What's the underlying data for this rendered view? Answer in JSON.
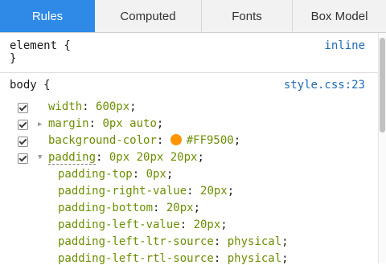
{
  "tabs": [
    {
      "label": "Rules"
    },
    {
      "label": "Computed"
    },
    {
      "label": "Fonts"
    },
    {
      "label": "Box Model"
    }
  ],
  "element_rule": {
    "selector": "element {",
    "close": "}",
    "origin": "inline"
  },
  "body_rule": {
    "selector": "body {",
    "origin": "style.css:23",
    "props": [
      {
        "name": "width",
        "value": "600px"
      },
      {
        "name": "margin",
        "value": "0px auto"
      },
      {
        "name": "background-color",
        "value": "#FF9500",
        "swatch_color": "#FF9500"
      },
      {
        "name": "padding",
        "value": "0px 20px 20px"
      }
    ],
    "padding_subprops": [
      {
        "name": "padding-top",
        "value": "0px"
      },
      {
        "name": "padding-right-value",
        "value": "20px"
      },
      {
        "name": "padding-bottom",
        "value": "20px"
      },
      {
        "name": "padding-left-value",
        "value": "20px"
      },
      {
        "name": "padding-left-ltr-source",
        "value": "physical"
      },
      {
        "name": "padding-left-rtl-source",
        "value": "physical"
      }
    ]
  },
  "icons": {
    "checkbox": "checkbox-checked-icon",
    "expand_collapsed": "triangle-right-icon",
    "expand_open": "triangle-down-icon"
  },
  "colors": {
    "accent_tab": "#2e8ae6",
    "property_green": "#6b8f00",
    "link_blue": "#1e6bb8"
  }
}
